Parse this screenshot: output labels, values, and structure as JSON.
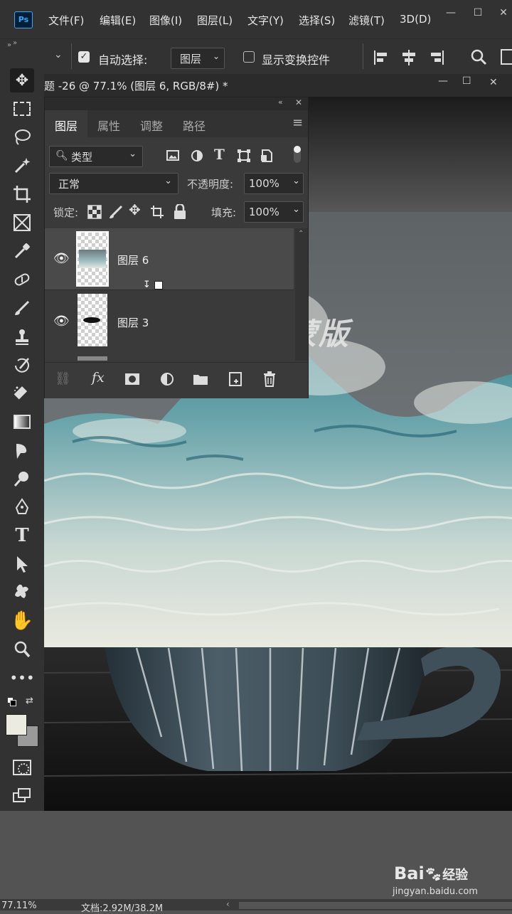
{
  "app": {
    "logo": "Ps"
  },
  "menu": [
    "文件(F)",
    "编辑(E)",
    "图像(I)",
    "图层(L)",
    "文字(Y)",
    "选择(S)",
    "滤镜(T)",
    "3D(D)"
  ],
  "options": {
    "auto_select_label": "自动选择:",
    "auto_select_target": "图层",
    "show_transform_label": "显示变换控件"
  },
  "document": {
    "tab_title": "题 -26 @ 77.1% (图层 6, RGB/8#) *"
  },
  "layers_panel": {
    "tabs": [
      "图层",
      "属性",
      "调整",
      "路径"
    ],
    "filter_kind": "类型",
    "blend_mode": "正常",
    "opacity_label": "不透明度:",
    "opacity_value": "100%",
    "lock_label": "锁定:",
    "fill_label": "填充:",
    "fill_value": "100%",
    "layers": [
      {
        "name": "图层 6",
        "selected": true
      },
      {
        "name": "图层 3",
        "selected": false
      }
    ],
    "footer_fx": "fx"
  },
  "overlay_caption": "创建剪切蒙版",
  "status": {
    "zoom": "77.11%",
    "doc_info": "文档:2.92M/38.2M"
  },
  "watermark": {
    "brand": "Bai",
    "brand2": "经验",
    "url": "jingyan.baidu.com"
  },
  "colors": {
    "accent": "#31a8ff",
    "ui_dark": "#323232",
    "panel": "#3a3a3a",
    "selected_row": "#4a4a4a"
  }
}
